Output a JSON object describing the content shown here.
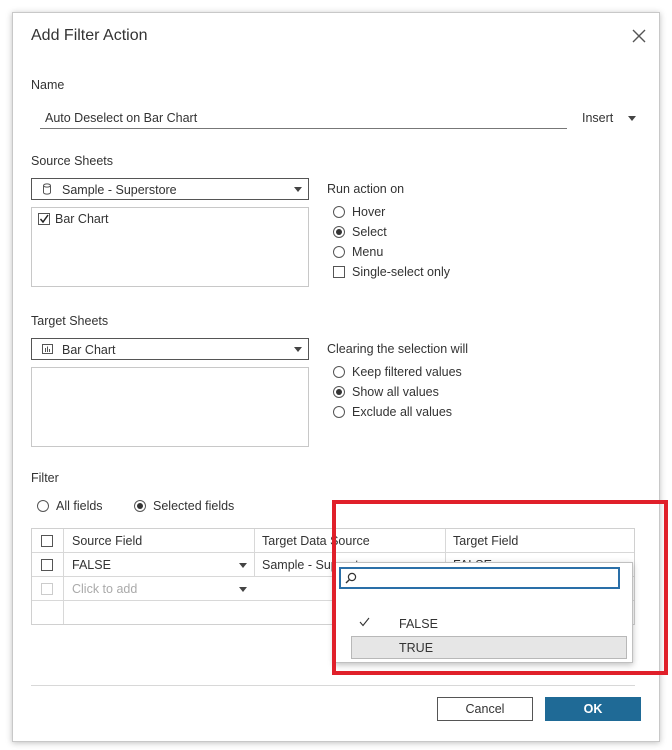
{
  "dialog": {
    "title": "Add Filter Action"
  },
  "name": {
    "label": "Name",
    "value": "Auto Deselect on Bar Chart",
    "insert_label": "Insert"
  },
  "source": {
    "label": "Source Sheets",
    "datasource": "Sample - Superstore",
    "sheets": [
      {
        "label": "Bar Chart",
        "checked": true
      }
    ],
    "run_label": "Run action on",
    "run_options": [
      "Hover",
      "Select",
      "Menu"
    ],
    "run_selected": "Select",
    "single_select_label": "Single-select only"
  },
  "target": {
    "label": "Target Sheets",
    "sheet": "Bar Chart",
    "clearing_label": "Clearing the selection will",
    "clearing_options": [
      "Keep filtered values",
      "Show all values",
      "Exclude all values"
    ],
    "clearing_selected": "Show all values"
  },
  "filter": {
    "label": "Filter",
    "all_fields": "All fields",
    "selected_fields": "Selected fields",
    "selected": "Selected fields",
    "columns": [
      "Source Field",
      "Target Data Source",
      "Target Field"
    ],
    "rows": [
      {
        "source": "FALSE",
        "target_ds": "Sample - Superstore",
        "target_field": "FALSE"
      }
    ],
    "add_row_placeholder": "Click to add"
  },
  "dropdown": {
    "search_placeholder": "",
    "options": [
      {
        "label": "FALSE",
        "checked": true
      },
      {
        "label": "TRUE",
        "checked": false,
        "hovered": true
      }
    ]
  },
  "buttons": {
    "cancel": "Cancel",
    "ok": "OK"
  },
  "colors": {
    "ok_button": "#1f6a96",
    "highlight_box": "#e0202a",
    "search_border": "#2a6fa8"
  }
}
